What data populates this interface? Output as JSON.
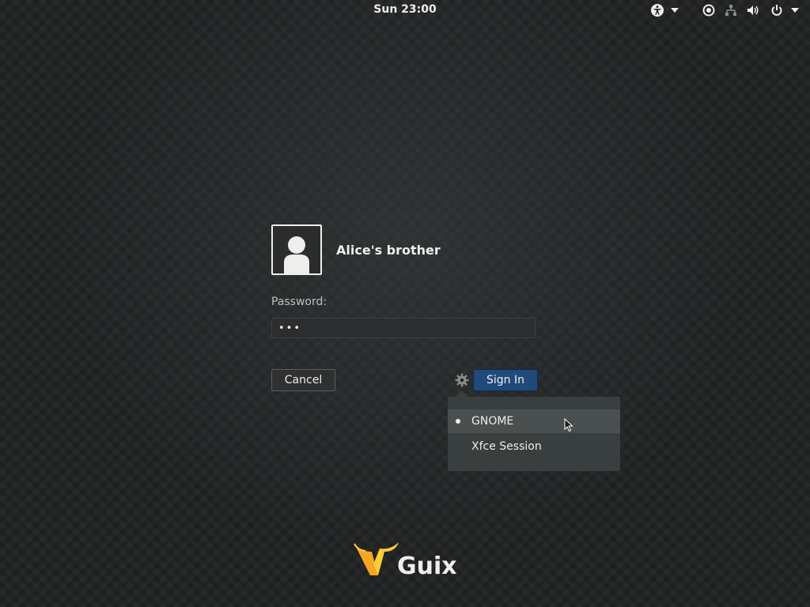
{
  "topbar": {
    "clock": "Sun 23:00",
    "icons": [
      "accessibility-icon",
      "chevron-down-icon",
      "display-icon",
      "network-icon",
      "volume-icon",
      "power-icon",
      "chevron-down-icon"
    ]
  },
  "login": {
    "user_name": "Alice's brother",
    "password_label": "Password:",
    "password_value": "•••",
    "cancel_label": "Cancel",
    "signin_label": "Sign In"
  },
  "session_menu": {
    "items": [
      {
        "label": "GNOME",
        "selected": true
      },
      {
        "label": "Xfce Session",
        "selected": false
      }
    ]
  },
  "logo": {
    "text": "Guix"
  },
  "colors": {
    "accent": "#1f4a7a",
    "logo_orange": "#f5a623",
    "logo_yellow": "#ffcc33"
  }
}
